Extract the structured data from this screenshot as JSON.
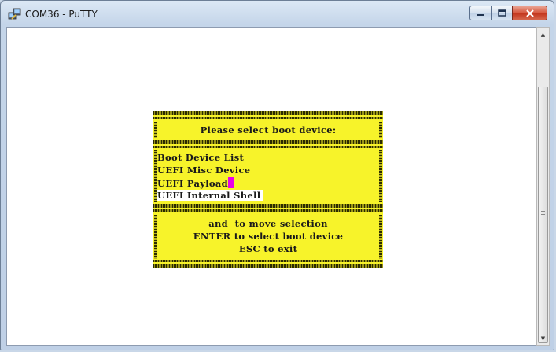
{
  "window": {
    "title": "COM36 - PuTTY",
    "buttons": {
      "minimize": "minimize",
      "maximize": "maximize",
      "close": "close"
    }
  },
  "terminal": {
    "dialog": {
      "header": "Please select boot device:",
      "items": [
        {
          "label": "Boot Device List",
          "selected": false
        },
        {
          "label": "UEFI Misc Device",
          "selected": false
        },
        {
          "label": "UEFI Payload",
          "selected": false,
          "cursor": true
        },
        {
          "label": "UEFI Internal Shell",
          "selected": true
        }
      ],
      "help": [
        "and  to move selection",
        "ENTER to select boot device",
        "ESC to exit"
      ]
    },
    "colors": {
      "dialog_bg": "#f7f32a",
      "cursor": "#e800e8",
      "selected_bg": "#ffffff"
    }
  },
  "scrollbar": {
    "up_arrow": "▲",
    "down_arrow": "▼"
  }
}
